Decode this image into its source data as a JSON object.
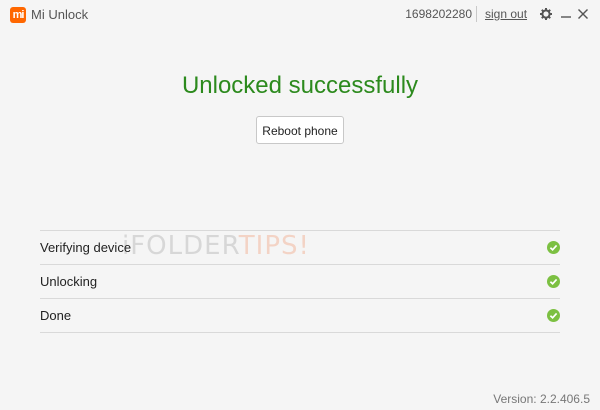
{
  "titlebar": {
    "logo_text": "mi",
    "app_title": "Mi Unlock",
    "account_id": "1698202280",
    "sign_out": "sign out",
    "icons": [
      "gear-icon",
      "minimize-icon",
      "close-icon"
    ]
  },
  "main": {
    "heading": "Unlocked successfully",
    "reboot_label": "Reboot phone"
  },
  "steps": [
    {
      "label": "Verifying device",
      "status": "done"
    },
    {
      "label": "Unlocking",
      "status": "done"
    },
    {
      "label": "Done",
      "status": "done"
    }
  ],
  "watermark": {
    "text_a": "iFOLDER",
    "text_b": "TIPS!"
  },
  "footer": {
    "version": "Version: 2.2.406.5"
  },
  "colors": {
    "accent_orange": "#ff6700",
    "success_green": "#2c8a1d",
    "check_green": "#7cc042"
  }
}
